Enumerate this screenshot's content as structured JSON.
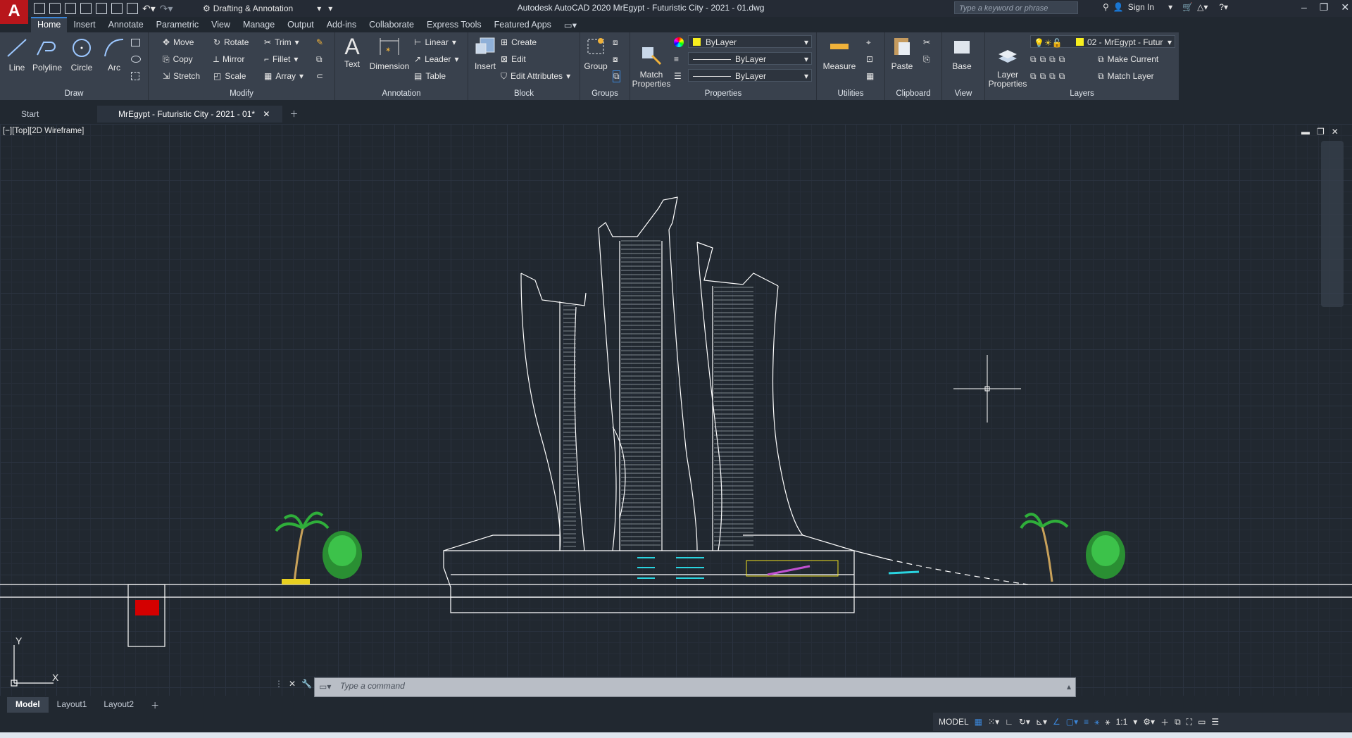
{
  "app": {
    "logo_letter": "A",
    "title": "Autodesk AutoCAD 2020    MrEgypt - Futuristic City - 2021 - 01.dwg",
    "workspace": "Drafting & Annotation",
    "search_placeholder": "Type a keyword or phrase",
    "sign_in": "Sign In",
    "window_controls": [
      "–",
      "❐",
      "✕"
    ]
  },
  "ribbon_tabs": [
    "Home",
    "Insert",
    "Annotate",
    "Parametric",
    "View",
    "Manage",
    "Output",
    "Add-ins",
    "Collaborate",
    "Express Tools",
    "Featured Apps"
  ],
  "ribbon": {
    "draw": {
      "title": "Draw",
      "line": "Line",
      "polyline": "Polyline",
      "circle": "Circle",
      "arc": "Arc"
    },
    "modify": {
      "title": "Modify",
      "move": "Move",
      "rotate": "Rotate",
      "trim": "Trim",
      "copy": "Copy",
      "mirror": "Mirror",
      "fillet": "Fillet",
      "stretch": "Stretch",
      "scale": "Scale",
      "array": "Array"
    },
    "annotation": {
      "title": "Annotation",
      "text": "Text",
      "dimension": "Dimension",
      "linear": "Linear",
      "leader": "Leader",
      "table": "Table"
    },
    "block": {
      "title": "Block",
      "insert": "Insert",
      "create": "Create",
      "edit": "Edit",
      "edit_attributes": "Edit Attributes"
    },
    "groups": {
      "title": "Groups",
      "group": "Group"
    },
    "properties": {
      "title": "Properties",
      "match": "Match\nProperties",
      "color": "ByLayer",
      "linetype": "ByLayer",
      "lineweight": "ByLayer"
    },
    "utilities": {
      "title": "Utilities",
      "measure": "Measure"
    },
    "clipboard": {
      "title": "Clipboard",
      "paste": "Paste"
    },
    "view": {
      "title": "View",
      "base": "Base"
    },
    "layers": {
      "title": "Layers",
      "layer_properties": "Layer\nProperties",
      "current_layer": "02 - MrEgypt - Futur",
      "make_current": "Make Current",
      "match_layer": "Match Layer"
    }
  },
  "doc_tabs": {
    "start": "Start",
    "active": "MrEgypt - Futuristic City - 2021 - 01*"
  },
  "viewport_label": "[−][Top][2D Wireframe]",
  "ucs": {
    "y": "Y",
    "x": "X"
  },
  "command": {
    "placeholder": "Type  a  command"
  },
  "layout_tabs": [
    "Model",
    "Layout1",
    "Layout2"
  ],
  "status": {
    "model": "MODEL",
    "scale": "1:1"
  },
  "colors": {
    "accent": "#3b86d8",
    "logo": "#b8161b",
    "layer_swatch": "#f8ef1e",
    "drawing_line": "#ffffff",
    "tree_green": "#2fae3a",
    "tree_trunk": "#c8a15a",
    "red_block": "#d40000",
    "cyan": "#2ad4e0",
    "magenta": "#c050d0"
  }
}
